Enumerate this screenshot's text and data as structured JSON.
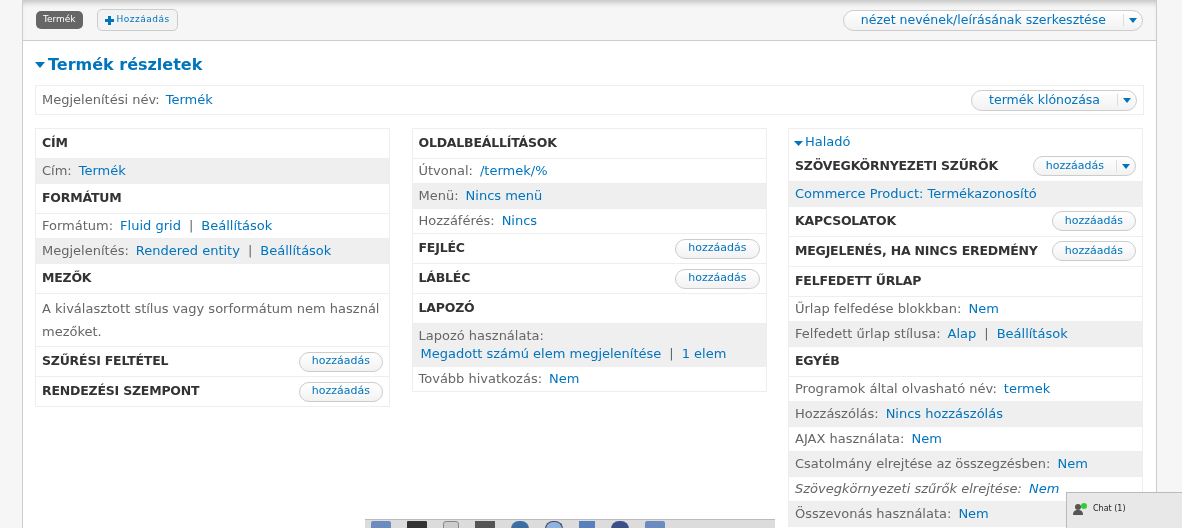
{
  "tabs": [
    {
      "label": "Termék",
      "selected": true
    }
  ],
  "add_display_button": {
    "label": "Hozzáadás"
  },
  "edit_view_button": {
    "label": "nézet nevének/leírásának szerkesztése",
    "dropdown": true
  },
  "section": {
    "title": "Termék részletek",
    "expanded": true
  },
  "display_name": {
    "label": "Megjelenítési név:",
    "value": "Termék"
  },
  "clone_button": {
    "label": "termék klónozása",
    "dropdown": true
  },
  "columns": [
    {
      "sections": [
        {
          "title": "CÍM",
          "rows": [
            {
              "kind": "setting",
              "label": "Cím:",
              "links": [
                "Termék"
              ],
              "shaded": true
            }
          ]
        },
        {
          "title": "FORMÁTUM",
          "rows": [
            {
              "kind": "setting",
              "label": "Formátum:",
              "links": [
                "Fluid grid",
                "Beállítások"
              ],
              "separator": "|",
              "shaded": false
            },
            {
              "kind": "setting",
              "label": "Megjelenítés:",
              "links": [
                "Rendered entity",
                "Beállítások"
              ],
              "separator": "|",
              "shaded": true
            }
          ]
        },
        {
          "title": "MEZŐK",
          "rows": [
            {
              "kind": "note",
              "text": "A kiválasztott stílus vagy sorformátum nem használ mezőket.",
              "shaded": false
            }
          ]
        },
        {
          "title": "SZŰRÉSI FELTÉTEL",
          "add_button": {
            "label": "hozzáadás",
            "dropdown": false
          }
        },
        {
          "title": "RENDEZÉSI SZEMPONT",
          "add_button": {
            "label": "hozzáadás",
            "dropdown": false
          }
        }
      ]
    },
    {
      "sections": [
        {
          "title": "OLDALBEÁLLÍTÁSOK",
          "rows": [
            {
              "kind": "setting",
              "label": "Útvonal:",
              "links": [
                "/termek/%"
              ],
              "shaded": false
            },
            {
              "kind": "setting",
              "label": "Menü:",
              "links": [
                "Nincs menü"
              ],
              "shaded": true
            },
            {
              "kind": "setting",
              "label": "Hozzáférés:",
              "links": [
                "Nincs"
              ],
              "shaded": false
            }
          ]
        },
        {
          "title": "FEJLÉC",
          "add_button": {
            "label": "hozzáadás",
            "dropdown": false
          }
        },
        {
          "title": "LÁBLÉC",
          "add_button": {
            "label": "hozzáadás",
            "dropdown": false
          }
        },
        {
          "title": "LAPOZÓ",
          "rows": [
            {
              "kind": "stacked",
              "label": "Lapozó használata:",
              "links": [
                "Megadott számú elem megjelenítése",
                "1 elem"
              ],
              "separator": "|",
              "shaded": true
            },
            {
              "kind": "setting",
              "label": "Tovább hivatkozás:",
              "links": [
                "Nem"
              ],
              "shaded": false
            }
          ]
        }
      ]
    },
    {
      "advanced": {
        "label": "Haladó",
        "expanded": true
      },
      "sections": [
        {
          "title": "SZÖVEGKÖRNYEZETI SZŰRŐK",
          "add_button": {
            "label": "hozzáadás",
            "dropdown": true
          },
          "rows": [
            {
              "kind": "link",
              "links": [
                "Commerce Product: Termékazonosító"
              ],
              "shaded": true
            }
          ]
        },
        {
          "title": "KAPCSOLATOK",
          "add_button": {
            "label": "hozzáadás",
            "dropdown": false
          }
        },
        {
          "title": "MEGJELENÉS, HA NINCS EREDMÉNY",
          "add_button": {
            "label": "hozzáadás",
            "dropdown": false
          }
        },
        {
          "title": "FELFEDETT ŰRLAP",
          "rows": [
            {
              "kind": "setting",
              "label": "Űrlap felfedése blokkban:",
              "links": [
                "Nem"
              ],
              "shaded": false
            },
            {
              "kind": "setting",
              "label": "Felfedett űrlap stílusa:",
              "links": [
                "Alap",
                "Beállítások"
              ],
              "separator": "|",
              "shaded": true
            }
          ]
        },
        {
          "title": "EGYÉB",
          "rows": [
            {
              "kind": "setting",
              "label": "Programok által olvasható név:",
              "links": [
                "termek"
              ],
              "shaded": false,
              "italic": false
            },
            {
              "kind": "setting",
              "label": "Hozzászólás:",
              "links": [
                "Nincs hozzászólás"
              ],
              "shaded": true,
              "italic": false
            },
            {
              "kind": "setting",
              "label": "AJAX használata:",
              "links": [
                "Nem"
              ],
              "shaded": false,
              "italic": false
            },
            {
              "kind": "setting",
              "label": "Csatolmány elrejtése az összegzésben:",
              "links": [
                "Nem"
              ],
              "shaded": true,
              "italic": false
            },
            {
              "kind": "setting",
              "label": "Szövegkörnyezeti szűrők elrejtése:",
              "links": [
                "Nem"
              ],
              "shaded": false,
              "italic": true
            },
            {
              "kind": "setting",
              "label": "Összevonás használata:",
              "links": [
                "Nem"
              ],
              "shaded": true,
              "italic": false
            }
          ]
        }
      ]
    }
  ],
  "chat": {
    "label": "Chat (1)"
  }
}
